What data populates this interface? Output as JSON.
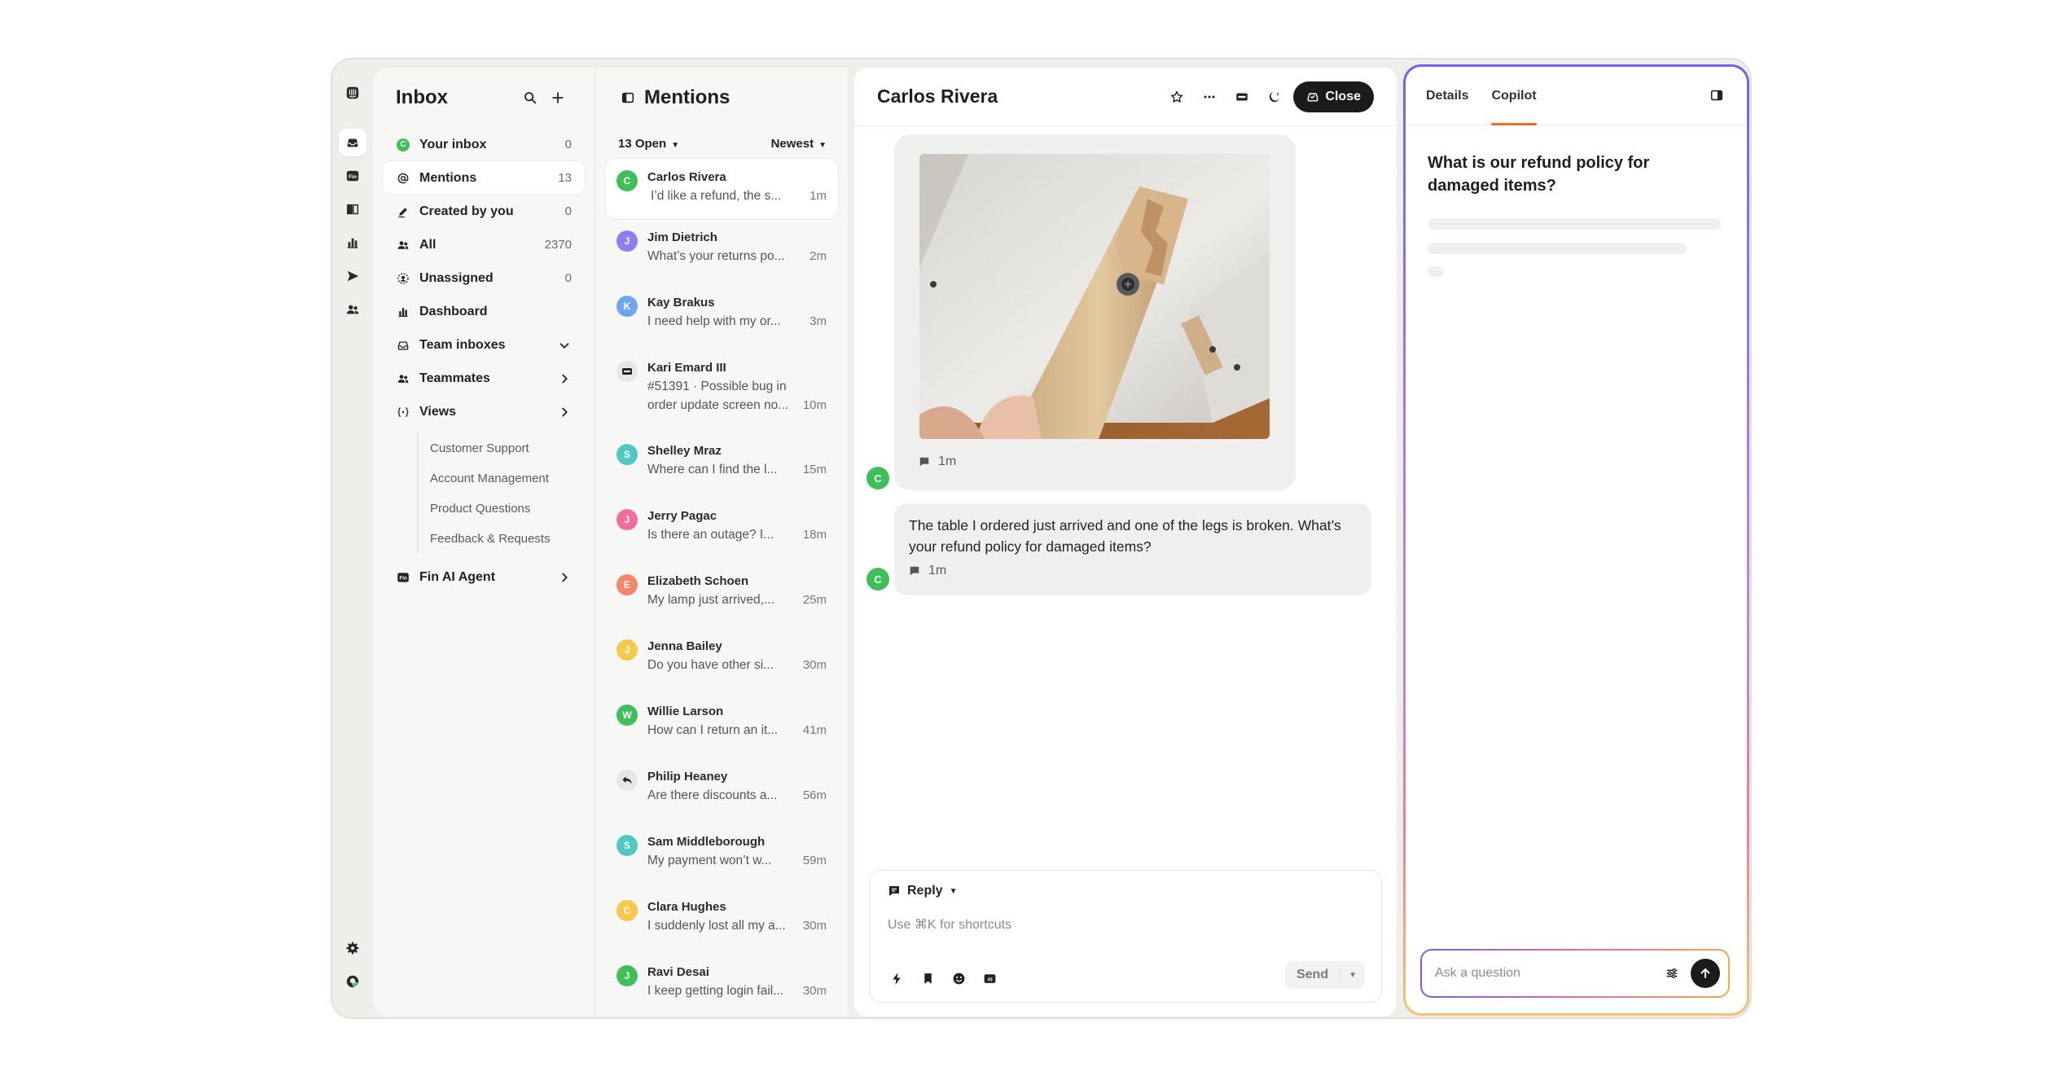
{
  "nav": {
    "title": "Inbox",
    "items": [
      {
        "label": "Your inbox",
        "count": "0"
      },
      {
        "label": "Mentions",
        "count": "13"
      },
      {
        "label": "Created by you",
        "count": "0"
      },
      {
        "label": "All",
        "count": "2370"
      },
      {
        "label": "Unassigned",
        "count": "0"
      },
      {
        "label": "Dashboard",
        "count": ""
      },
      {
        "label": "Team inboxes",
        "count": ""
      },
      {
        "label": "Teammates",
        "count": ""
      },
      {
        "label": "Views",
        "count": ""
      },
      {
        "label": "Fin AI Agent",
        "count": ""
      }
    ],
    "views": [
      "Customer Support",
      "Account Management",
      "Product Questions",
      "Feedback & Requests"
    ],
    "your_inbox_avatar": "C"
  },
  "mentions": {
    "title": "Mentions",
    "filter_open": "13 Open",
    "sort": "Newest",
    "conversations": [
      {
        "initial": "C",
        "color": "#3fbf59",
        "name": "Carlos Rivera",
        "preview": "I’d like a refund, the s...",
        "time": "1m"
      },
      {
        "initial": "J",
        "color": "#8f7cf0",
        "name": "Jim Dietrich",
        "preview": "What’s your returns po...",
        "time": "2m"
      },
      {
        "initial": "K",
        "color": "#6ea4f2",
        "name": "Kay Brakus",
        "preview": "I need help with my or...",
        "time": "3m"
      },
      {
        "initial": "",
        "color": "#e6e6e3",
        "name": "Kari Emard III",
        "line1": "#51391 · Possible bug in",
        "preview": "order update screen no...",
        "time": "10m"
      },
      {
        "initial": "S",
        "color": "#4ec9c2",
        "name": "Shelley Mraz",
        "preview": "Where can I find the l...",
        "time": "15m"
      },
      {
        "initial": "J",
        "color": "#ee6f9d",
        "name": "Jerry Pagac",
        "preview": "Is there an outage? I...",
        "time": "18m"
      },
      {
        "initial": "E",
        "color": "#f5866a",
        "name": "Elizabeth Schoen",
        "preview": "My lamp just arrived,...",
        "time": "25m"
      },
      {
        "initial": "J",
        "color": "#f6c94b",
        "name": "Jenna Bailey",
        "preview": "Do you have other si...",
        "time": "30m"
      },
      {
        "initial": "W",
        "color": "#3fbf59",
        "name": "Willie Larson",
        "preview": "How can I return an it...",
        "time": "41m"
      },
      {
        "initial": "",
        "color": "#e6e6e3",
        "name": "Philip Heaney",
        "preview": "Are there discounts a...",
        "time": "56m"
      },
      {
        "initial": "S",
        "color": "#4ec9c2",
        "name": "Sam Middleborough",
        "preview": "My payment won’t w...",
        "time": "59m"
      },
      {
        "initial": "C",
        "color": "#f6c94b",
        "name": "Clara Hughes",
        "preview": "I suddenly lost all my a...",
        "time": "30m"
      },
      {
        "initial": "J",
        "color": "#3fbf59",
        "name": "Ravi Desai",
        "preview": "I keep getting login fail...",
        "time": "30m"
      }
    ]
  },
  "conversation": {
    "title": "Carlos Rivera",
    "close_label": "Close",
    "image_message_time": "1m",
    "text_message": "The table I ordered just arrived and one of the legs is broken. What’s your refund policy for damaged items?",
    "text_message_time": "1m",
    "avatar_initial": "C",
    "composer": {
      "reply_label": "Reply",
      "placeholder": "Use ⌘K for shortcuts",
      "send_label": "Send"
    }
  },
  "copilot": {
    "tabs": [
      "Details",
      "Copilot"
    ],
    "active_tab": "Copilot",
    "question": "What is our refund policy for damaged items?",
    "ask_placeholder": "Ask a question"
  },
  "colors": {
    "accent_orange": "#f06a2a",
    "dark_button": "#1b1b1b",
    "green_avatar": "#3fbf59"
  }
}
